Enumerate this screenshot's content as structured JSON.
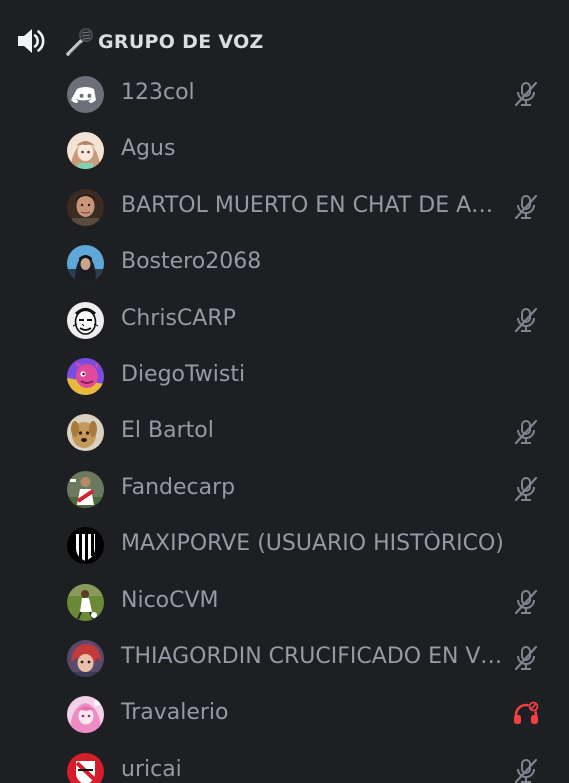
{
  "channel": {
    "name": "GRUPO DE VOZ",
    "speaker_icon": "speaker-icon",
    "prefix_icon": "microphone-emoji-icon"
  },
  "colors": {
    "background": "#1e1f23",
    "member_text": "#949ba4",
    "header_text": "#dbdee1",
    "muted_icon": "#80848e",
    "deafened_icon": "#f23f42",
    "discord_blurple": "#5865f2"
  },
  "members": [
    {
      "name": "123col",
      "avatar_icon": "discord-default-avatar-icon",
      "status": "muted"
    },
    {
      "name": "Agus",
      "avatar_icon": "anime-girl-avatar-icon",
      "status": ""
    },
    {
      "name": "BARTOL MUERTO EN CHAT DE AUDIO",
      "avatar_icon": "person-photo-avatar-icon",
      "status": "muted"
    },
    {
      "name": "Bostero2068",
      "avatar_icon": "hooded-figure-avatar-icon",
      "status": ""
    },
    {
      "name": "ChrisCARP",
      "avatar_icon": "sketch-face-avatar-icon",
      "status": "muted"
    },
    {
      "name": "DiegoTwisti",
      "avatar_icon": "pink-creature-avatar-icon",
      "status": ""
    },
    {
      "name": "El Bartol",
      "avatar_icon": "dog-avatar-icon",
      "status": "muted"
    },
    {
      "name": "Fandecarp",
      "avatar_icon": "football-player-avatar-icon",
      "status": "muted"
    },
    {
      "name": "MAXIPORVE (USUARIO HISTÓRICO)",
      "avatar_icon": "striped-shield-avatar-icon",
      "status": ""
    },
    {
      "name": "NicoCVM",
      "avatar_icon": "football-field-avatar-icon",
      "status": "muted"
    },
    {
      "name": "THIAGORDIN CRUCIFICADO EN VOZ",
      "avatar_icon": "red-hair-character-avatar-icon",
      "status": "muted"
    },
    {
      "name": "Travalerio",
      "avatar_icon": "pink-anime-avatar-icon",
      "status": "deafened"
    },
    {
      "name": "uricai",
      "avatar_icon": "red-shield-avatar-icon",
      "status": "muted"
    }
  ]
}
